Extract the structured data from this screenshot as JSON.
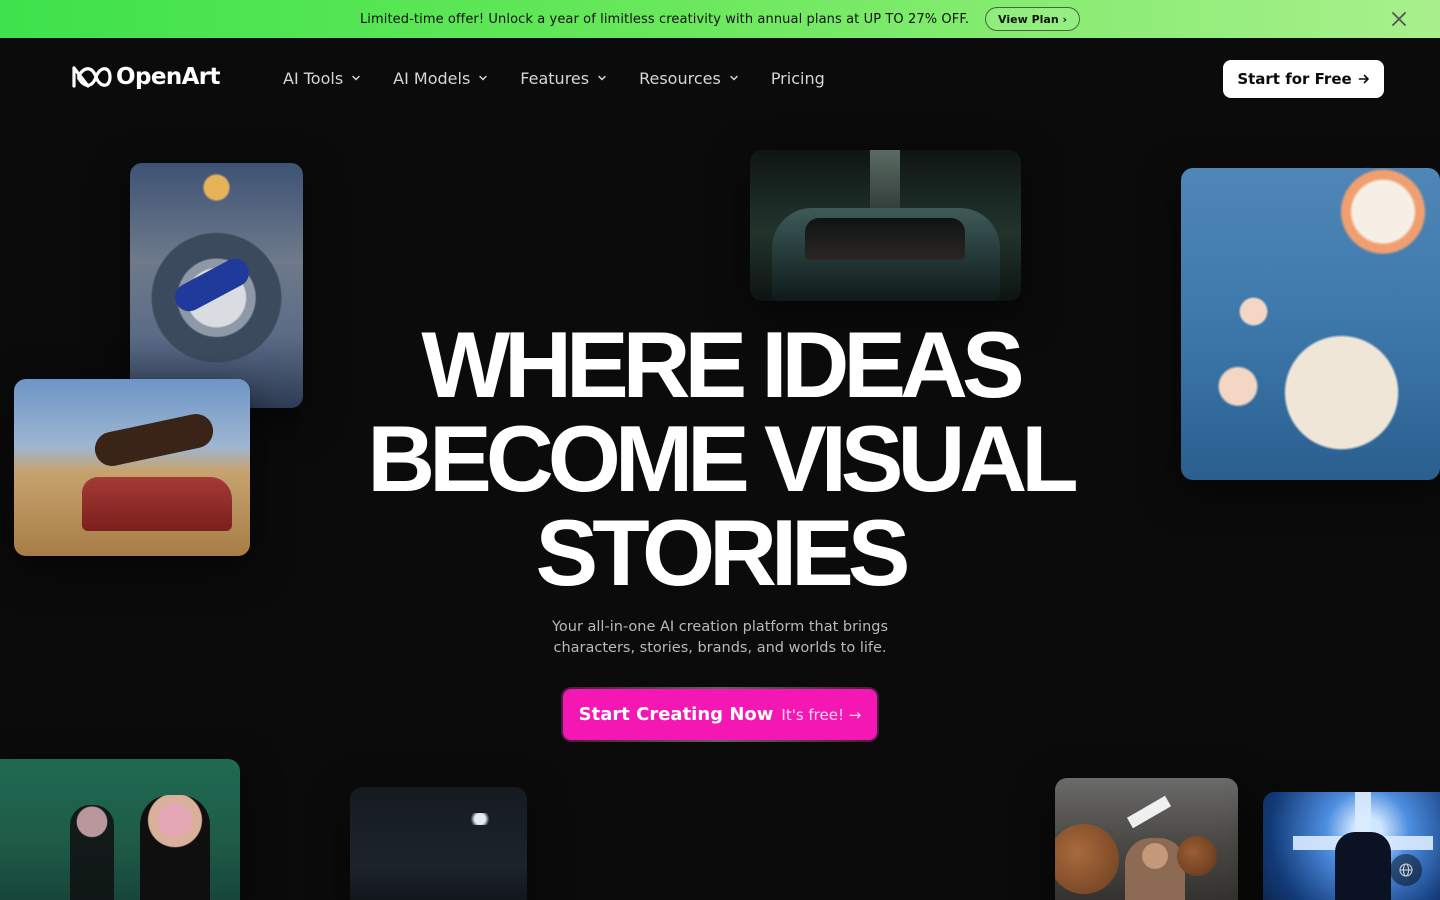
{
  "promo": {
    "text": "Limited-time offer! Unlock a year of limitless creativity with annual plans at UP TO 27% OFF.",
    "button_label": "View Plan ›"
  },
  "nav": {
    "logo_text": "OpenArt",
    "items": [
      {
        "label": "AI Tools",
        "has_dropdown": true
      },
      {
        "label": "AI Models",
        "has_dropdown": true
      },
      {
        "label": "Features",
        "has_dropdown": true
      },
      {
        "label": "Resources",
        "has_dropdown": true
      },
      {
        "label": "Pricing",
        "has_dropdown": false
      }
    ],
    "cta_label": "Start for Free"
  },
  "hero": {
    "title_lines": [
      "WHERE IDEAS",
      "BECOME VISUAL",
      "STORIES"
    ],
    "subtitle_line1": "Your all-in-one AI creation platform that brings",
    "subtitle_line2": "characters, stories, brands, and worlds to life.",
    "cta_main": "Start Creating Now",
    "cta_sub": "It's free! →"
  },
  "colors": {
    "accent": "#f417b4",
    "banner_green": "#3ee24c",
    "background": "#0b0b0c"
  },
  "icons": [
    "close-icon",
    "logo-infinity-icon",
    "chevron-down-icon",
    "arrow-right-icon",
    "globe-icon"
  ]
}
